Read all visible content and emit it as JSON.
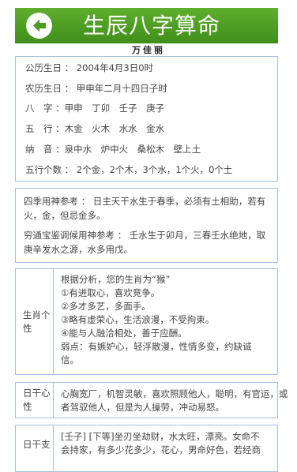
{
  "header": {
    "title": "生辰八字算命",
    "back_icon": "back-arrow-icon",
    "bg_color": "#4a9b22"
  },
  "person": {
    "name": "万佳丽"
  },
  "basic": {
    "solar_birthday": "公历生日 ： 2004年4月3日0时",
    "lunar_birthday": "农历生日 ： 甲申年二月十四日子时",
    "bazi": "八　字 ：甲申　丁卯　壬子　庚子",
    "wuxing": "五　行 ：木金　火木　水水　金水",
    "nayin": "纳　音 ：泉中水　炉中火　桑松木　壁上土",
    "wuxing_count": "五行个数 ： 2个金，2个木，3个水，1个火，0个土"
  },
  "reference": {
    "siji": "四季用神参考 ： 日主天干水生于春季，必须有土相助，若有火，金，但忌金多。",
    "qiongtong": "穷通宝鉴调候用神参考 ： 壬水生于卯月，三春壬水绝地，取庚辛发水之源，水多用戊。"
  },
  "personality": {
    "label": "生肖个性",
    "lines": [
      "根据分析，您的生肖为“猴”",
      "①有进取心，喜欢竞争。",
      "②多才多艺，多面手。",
      "③略有虚荣心，生活浪漫，不受拘束。",
      "④能与人融洽相处，善于应酬。",
      "弱点：有嫉妒心，轻浮散漫，性情多变，约缺诚",
      "信。"
    ]
  },
  "rigan": {
    "label": "日干心性",
    "lines": [
      "心胸宽厂，机智灵敏，喜欢照顾他人，聪明，有官运，或",
      "者驾驭他人，但是为人操劳，冲动易怒。"
    ]
  },
  "rizhi": {
    "label": "日干支",
    "lines": [
      "[壬子] [下等]坐刃坐劫财，水太旺，漂亮。女命不",
      "会持家，有多少花多少，花心，男命好色，若经商"
    ]
  }
}
